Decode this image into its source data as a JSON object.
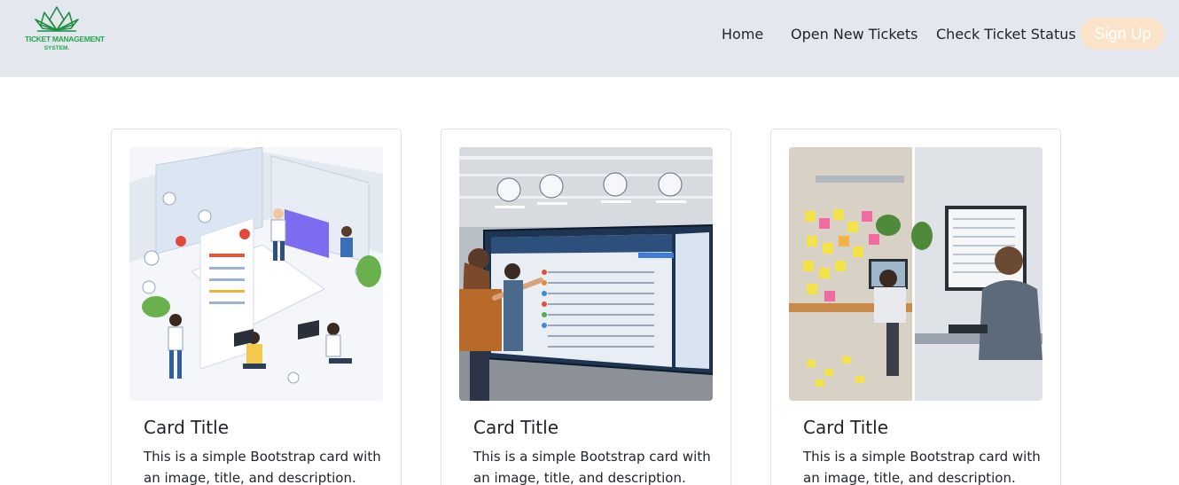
{
  "brand": {
    "line1": "TICKET MANAGEMENT",
    "line2": "SYSTEM.",
    "color": "#22a84a"
  },
  "nav": {
    "links": [
      "Home",
      "Open New Tickets",
      "Check Ticket Status"
    ],
    "signup_label": "Sign Up",
    "signup_color": "#fae3c8"
  },
  "cards": [
    {
      "title": "Card Title",
      "text": "This is a simple Bootstrap card with an image, title, and description."
    },
    {
      "title": "Card Title",
      "text": "This is a simple Bootstrap card with an image, title, and description."
    },
    {
      "title": "Card Title",
      "text": "This is a simple Bootstrap card with an image, title, and description."
    }
  ]
}
